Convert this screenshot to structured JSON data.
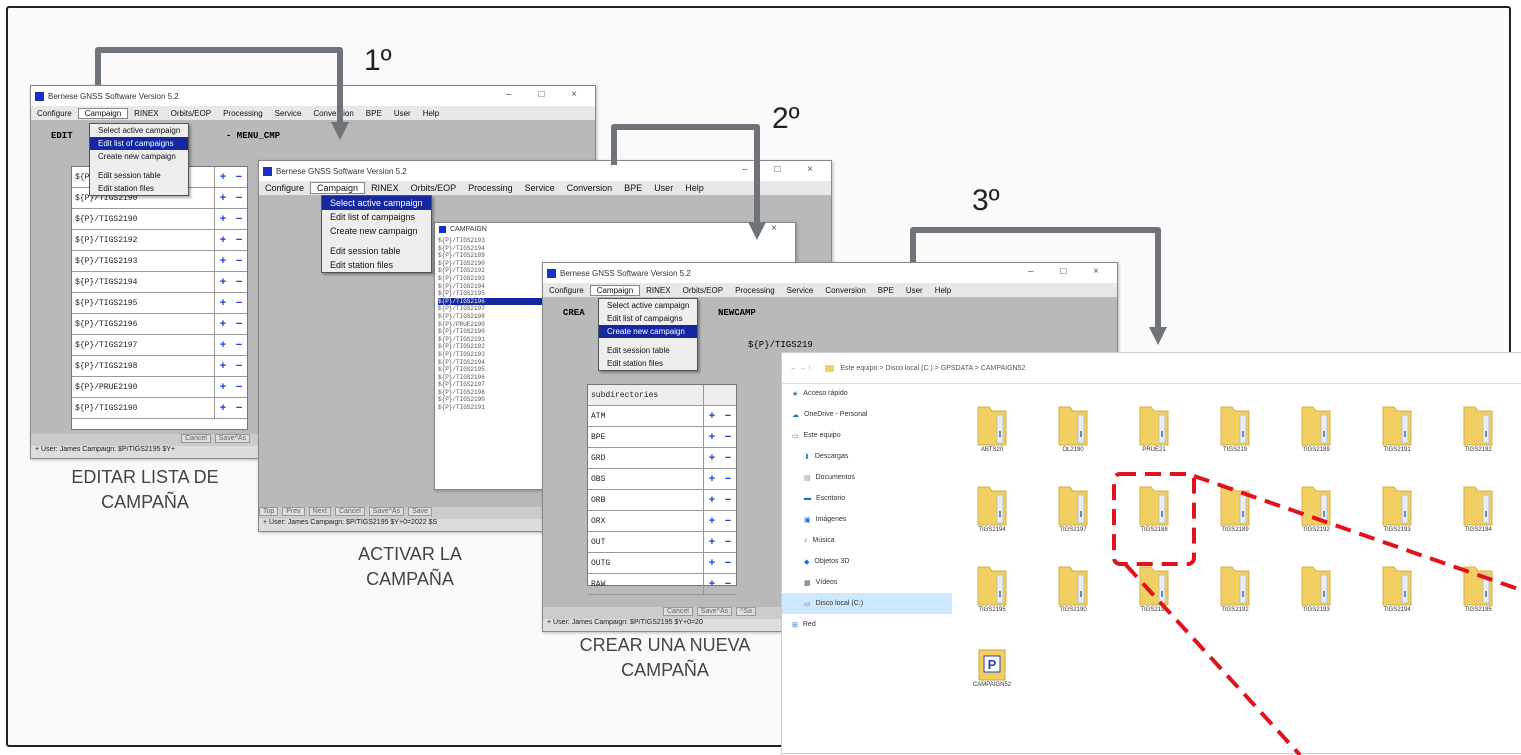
{
  "steps": {
    "s1": "1º",
    "s2": "2º",
    "s3": "3º"
  },
  "captions": {
    "c1_line1": "EDITAR LISTA DE",
    "c1_line2": "CAMPAÑA",
    "c2_line1": "ACTIVAR LA",
    "c2_line2": "CAMPAÑA",
    "c3_line1": "CREAR UNA NUEVA",
    "c3_line2": "CAMPAÑA"
  },
  "app": {
    "title": "Bernese GNSS Software Version 5.2",
    "menu": [
      "Configure",
      "Campaign",
      "RINEX",
      "Orbits/EOP",
      "Processing",
      "Service",
      "Conversion",
      "BPE",
      "User",
      "Help"
    ],
    "campaign_menu": [
      "Select active campaign",
      "Edit list of campaigns",
      "Create new campaign",
      "Edit session table",
      "Edit station files"
    ]
  },
  "win1": {
    "header_left": "EDIT",
    "header_right": "- MENU_CMP",
    "rows": [
      "${P}/TIGS2189",
      "${P}/TIGS2190",
      "${P}/TIGS2190",
      "${P}/TIGS2192",
      "${P}/TIGS2193",
      "${P}/TIGS2194",
      "${P}/TIGS2195",
      "${P}/TIGS2196",
      "${P}/TIGS2197",
      "${P}/TIGS2198",
      "${P}/PRUE2190",
      "${P}/TIGS2190"
    ],
    "buttons": [
      "Cancel",
      "Save^As"
    ],
    "status": "+ User: James Campaign: $P/TIGS2195 $Y+"
  },
  "win2": {
    "list": [
      "${P}/TIGS2193",
      "${P}/TIGS2194",
      "${P}/TIGS2189",
      "${P}/TIGS2190",
      "${P}/TIGS2192",
      "${P}/TIGS2193",
      "${P}/TIGS2194",
      "${P}/TIGS2195",
      "${P}/TIGS2196",
      "${P}/TIGS2197",
      "${P}/TIGS2198",
      "${P}/PRUE2190",
      "${P}/TIGS2190",
      "${P}/TIGS2191",
      "${P}/TIGS2192",
      "${P}/TIGS2193",
      "${P}/TIGS2194",
      "${P}/TIGS2195",
      "${P}/TIGS2196",
      "${P}/TIGS2197",
      "${P}/TIGS2198",
      "${P}/TIGS2190",
      "${P}/TIGS2191"
    ],
    "dialog_title": "CAMPAIGN",
    "buttons": [
      "Top",
      "Prev",
      "Next",
      "Cancel",
      "Save^As",
      "Save"
    ],
    "status": "+ User: James Campaign: $P/TIGS2195 $Y+0=2022 $S"
  },
  "win3": {
    "header_left": "CREA",
    "header_right": "NEWCAMP",
    "path_value": "${P}/TIGS219",
    "col_header": "subdirectories",
    "rows": [
      "ATM",
      "BPE",
      "GRD",
      "OBS",
      "ORB",
      "ORX",
      "OUT",
      "OUTG",
      "RAW"
    ],
    "buttons": [
      "Cancel",
      "Save^As",
      "^Sa"
    ],
    "status": "+ User: James Campaign: $P/TIGS2195 $Y+0=20"
  },
  "explorer": {
    "breadcrumb": "Este equipo  >  Disco local (C:)  >  GPSDATA  >  CAMPAIGN52",
    "nav": [
      "Acceso rápido",
      "OneDrive - Personal",
      "Este equipo",
      "Descargas",
      "Documentos",
      "Escritorio",
      "Imágenes",
      "Música",
      "Objetos 3D",
      "Vídeos",
      "Disco local (C:)",
      "Red"
    ],
    "folders": [
      "ABTS20",
      "OL2190",
      "PRUE21",
      "TIGS219",
      "TIGS2189",
      "TIGS2191",
      "TIGS2192",
      "TIGS2194",
      "TIGS2197",
      "TIGS2188",
      "TIGS2189",
      "TIGS2192",
      "TIGS2193",
      "TIGS2194",
      "TIGS2195",
      "TIGS2190",
      "TIGS2191",
      "TIGS2192",
      "TIGS2193",
      "TIGS2194",
      "TIGS2195"
    ],
    "project_file": "CAMPAIGN52"
  },
  "colors": {
    "arrow": "#6f747a",
    "dash": "#e0121b",
    "menu_select": "#1628a0",
    "folder": "#f2cf63"
  }
}
